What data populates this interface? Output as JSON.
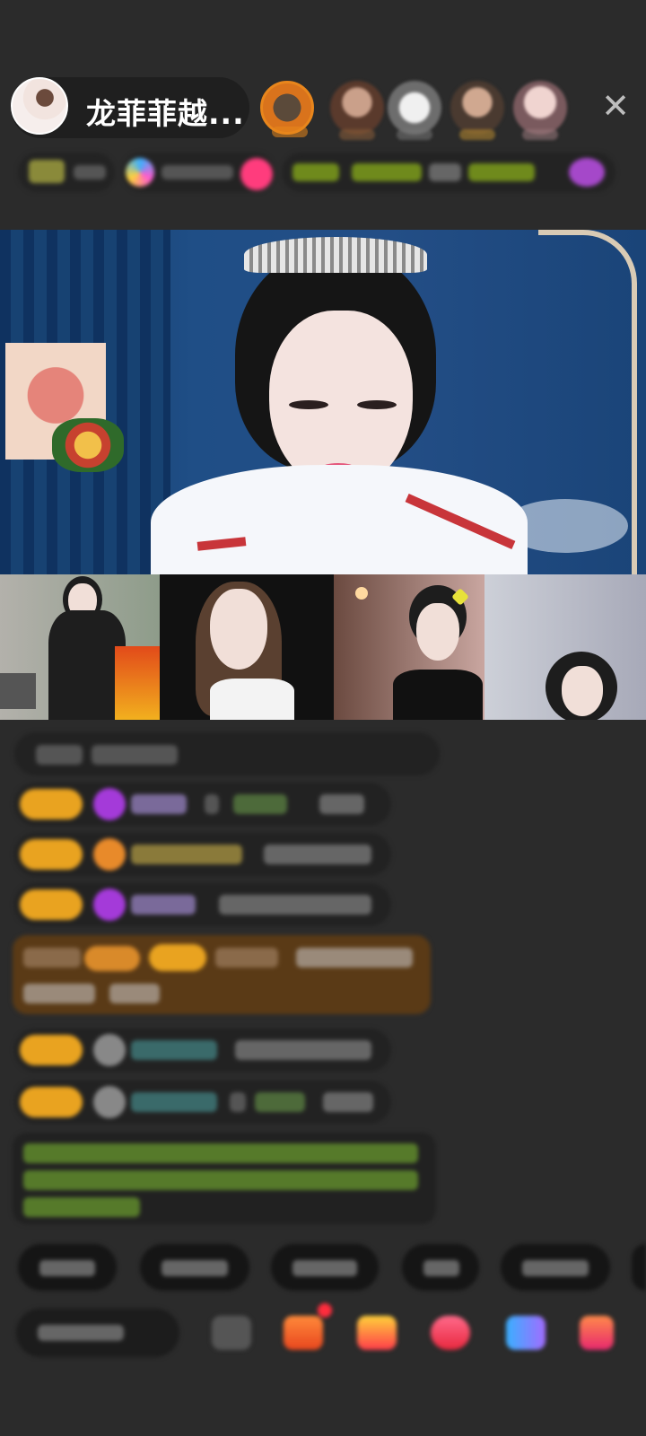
{
  "host": {
    "name": "龙菲菲越..."
  },
  "icons": {
    "close": "close-icon",
    "gift_box": "gift-box-icon",
    "gift": "gift-icon",
    "heart": "heart-icon",
    "chat_bubble": "message-icon",
    "gallery": "more-icon"
  },
  "colors": {
    "background": "#2b2b2b",
    "badge_gold": "#e9a320",
    "chat_green": "#7fb23a",
    "notice_brown": "#5a3a16",
    "accent_pink": "#ff3c7d"
  }
}
